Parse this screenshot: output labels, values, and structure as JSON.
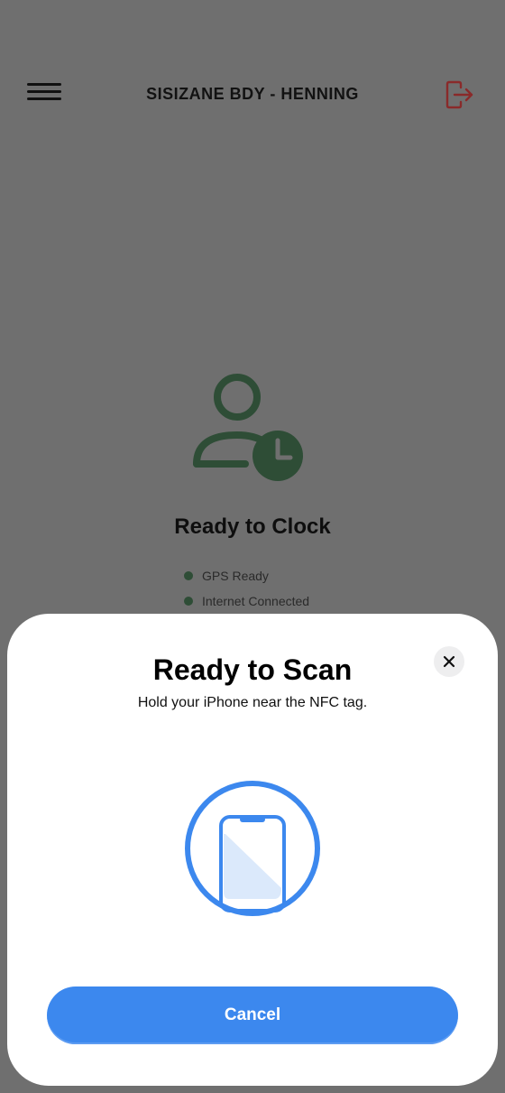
{
  "header": {
    "title": "SISIZANE BDY - HENNING",
    "menu_icon": "hamburger-icon",
    "logout_icon": "logout-icon"
  },
  "main": {
    "icon": "user-clock-icon",
    "title": "Ready to Clock",
    "status_items": [
      {
        "label": "GPS Ready",
        "color": "#2e4d36"
      },
      {
        "label": "Internet Connected",
        "color": "#2e4d36"
      }
    ]
  },
  "scan_sheet": {
    "title": "Ready to Scan",
    "subtitle": "Hold your iPhone near the NFC tag.",
    "illustration_icon": "phone-scan-icon",
    "close_icon": "close-icon",
    "cancel_label": "Cancel"
  },
  "colors": {
    "accent": "#3c88ee",
    "icon_green": "#2e4d36",
    "logout_red": "#8a2a2a",
    "overlay": "#6f6f6f"
  }
}
